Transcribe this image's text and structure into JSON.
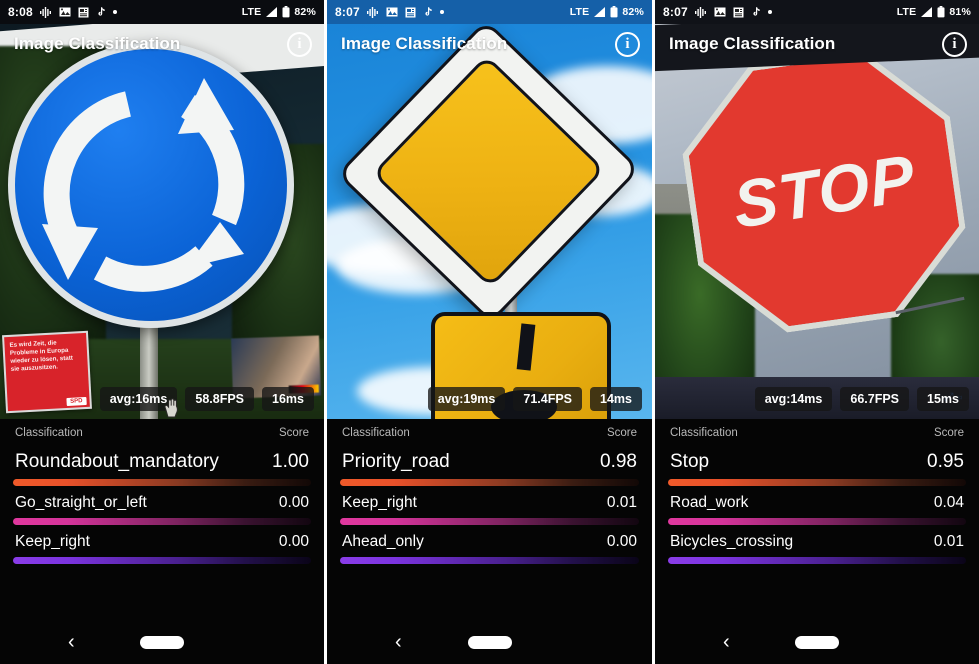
{
  "panels": [
    {
      "status": {
        "time": "8:08",
        "icons": [
          "equalizer-icon",
          "image-icon",
          "news-icon",
          "tiktok-icon",
          "dot-icon"
        ],
        "network": "LTE",
        "battery": "82%"
      },
      "app_title": "Image Classification",
      "info_label": "i",
      "scene": "roundabout-mandatory-sign",
      "poster_text": "Es wird Zeit, die Probleme in Europa wieder zu lösen, statt sie auszusitzen.",
      "poster_brand": "SPD",
      "badges": {
        "avg": "avg:16ms",
        "fps": "58.8FPS",
        "latest": "16ms"
      },
      "cursor_visible": true,
      "table": {
        "col_class": "Classification",
        "col_score": "Score"
      },
      "rows": [
        {
          "label": "Roundabout_mandatory",
          "score": "1.00",
          "pct": 100
        },
        {
          "label": "Go_straight_or_left",
          "score": "0.00",
          "pct": 100
        },
        {
          "label": "Keep_right",
          "score": "0.00",
          "pct": 100
        }
      ],
      "nav": {
        "back": "‹",
        "home": "home-pill"
      }
    },
    {
      "status": {
        "time": "8:07",
        "icons": [
          "equalizer-icon",
          "image-icon",
          "news-icon",
          "tiktok-icon",
          "dot-icon"
        ],
        "network": "LTE",
        "battery": "82%"
      },
      "app_title": "Image Classification",
      "info_label": "i",
      "scene": "priority-road-sign",
      "badges": {
        "avg": "avg:19ms",
        "fps": "71.4FPS",
        "latest": "14ms"
      },
      "cursor_visible": false,
      "table": {
        "col_class": "Classification",
        "col_score": "Score"
      },
      "rows": [
        {
          "label": "Priority_road",
          "score": "0.98",
          "pct": 100
        },
        {
          "label": "Keep_right",
          "score": "0.01",
          "pct": 100
        },
        {
          "label": "Ahead_only",
          "score": "0.00",
          "pct": 100
        }
      ],
      "nav": {
        "back": "‹",
        "home": "home-pill"
      }
    },
    {
      "status": {
        "time": "8:07",
        "icons": [
          "equalizer-icon",
          "image-icon",
          "news-icon",
          "tiktok-icon",
          "dot-icon"
        ],
        "network": "LTE",
        "battery": "81%"
      },
      "app_title": "Image Classification",
      "info_label": "i",
      "scene": "stop-sign",
      "sign_text": "STOP",
      "badges": {
        "avg": "avg:14ms",
        "fps": "66.7FPS",
        "latest": "15ms"
      },
      "cursor_visible": false,
      "table": {
        "col_class": "Classification",
        "col_score": "Score"
      },
      "rows": [
        {
          "label": "Stop",
          "score": "0.95",
          "pct": 100
        },
        {
          "label": "Road_work",
          "score": "0.04",
          "pct": 100
        },
        {
          "label": "Bicycles_crossing",
          "score": "0.01",
          "pct": 100
        }
      ],
      "nav": {
        "back": "‹",
        "home": "home-pill"
      }
    }
  ],
  "colors": {
    "bar_top": "#e8512a",
    "bar_mid": "#d4349a",
    "bar_low": "#7c34e0",
    "status_blue": "#1560a8",
    "background": "#050505"
  }
}
